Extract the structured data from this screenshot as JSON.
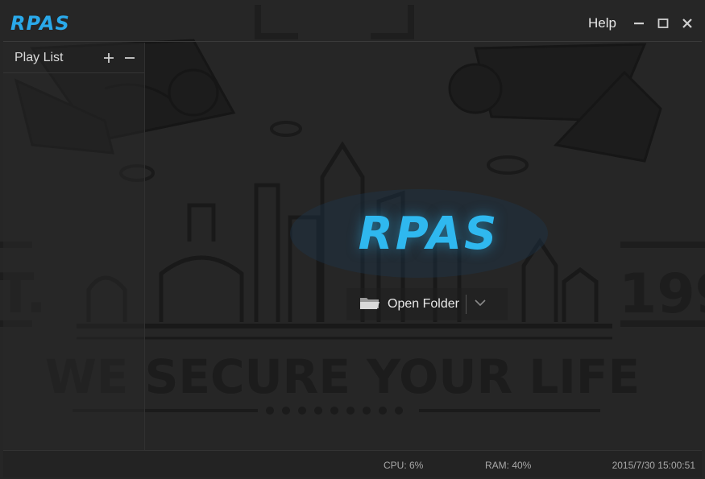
{
  "app": {
    "logo_text": "RPAS",
    "help_label": "Help"
  },
  "window_controls": {
    "minimize_icon": "minimize-icon",
    "maximize_icon": "maximize-icon",
    "close_icon": "close-icon"
  },
  "sidebar": {
    "title": "Play List",
    "add_icon": "plus-icon",
    "remove_icon": "minus-icon"
  },
  "main": {
    "logo_text": "RPAS",
    "open_folder_label": "Open Folder",
    "folder_icon": "folder-icon",
    "dropdown_icon": "chevron-down-icon"
  },
  "background": {
    "slogan": "WE SECURE YOUR LIFE",
    "year_fragment": "199",
    "est_fragment": "T."
  },
  "status": {
    "cpu": "CPU: 6%",
    "ram": "RAM: 40%",
    "datetime": "2015/7/30 15:00:51"
  },
  "colors": {
    "accent": "#2fb8ef",
    "background": "#262626",
    "text": "#e6e6e6"
  }
}
